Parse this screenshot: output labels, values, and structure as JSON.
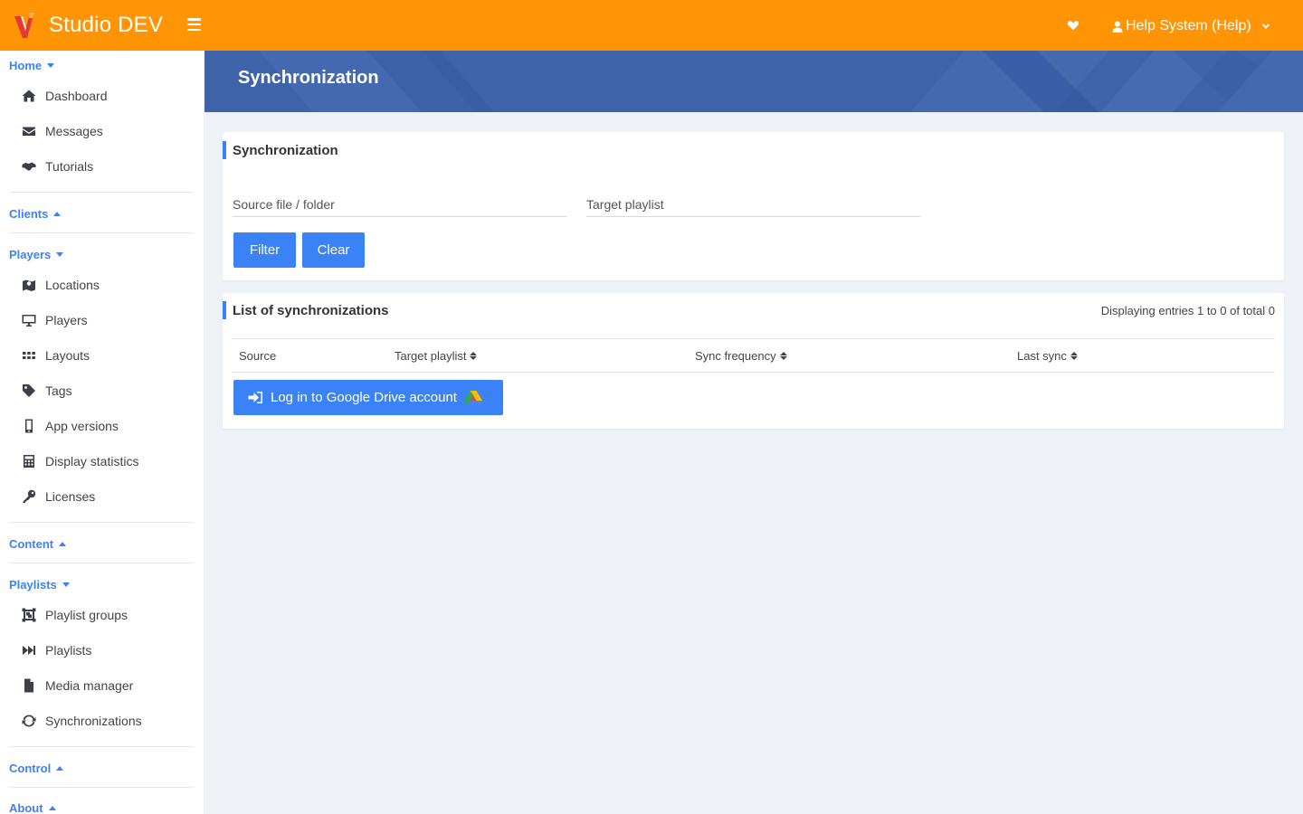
{
  "header": {
    "app_title": "Studio DEV",
    "user_label": "Help System (Help)",
    "brand_color": "#ff9505"
  },
  "sidebar": {
    "home": {
      "label": "Home",
      "items": [
        {
          "label": "Dashboard",
          "icon": "home-icon"
        },
        {
          "label": "Messages",
          "icon": "envelope-icon"
        },
        {
          "label": "Tutorials",
          "icon": "handshake-icon"
        }
      ]
    },
    "clients": {
      "label": "Clients"
    },
    "players": {
      "label": "Players",
      "items": [
        {
          "label": "Locations",
          "icon": "map-icon"
        },
        {
          "label": "Players",
          "icon": "monitor-icon"
        },
        {
          "label": "Layouts",
          "icon": "grid-icon"
        },
        {
          "label": "Tags",
          "icon": "tag-icon"
        },
        {
          "label": "App versions",
          "icon": "mobile-icon"
        },
        {
          "label": "Display statistics",
          "icon": "calculator-icon"
        },
        {
          "label": "Licenses",
          "icon": "key-icon"
        }
      ]
    },
    "content": {
      "label": "Content"
    },
    "playlists": {
      "label": "Playlists",
      "items": [
        {
          "label": "Playlist groups",
          "icon": "object-group-icon"
        },
        {
          "label": "Playlists",
          "icon": "fast-forward-icon"
        },
        {
          "label": "Media manager",
          "icon": "file-icon"
        },
        {
          "label": "Synchronizations",
          "icon": "sync-icon"
        }
      ]
    },
    "control": {
      "label": "Control"
    },
    "about": {
      "label": "About"
    }
  },
  "banner": {
    "title": "Synchronization"
  },
  "filter_card": {
    "title": "Synchronization",
    "source_placeholder": "Source file / folder",
    "target_placeholder": "Target playlist",
    "filter_label": "Filter",
    "clear_label": "Clear"
  },
  "list_card": {
    "title": "List of synchronizations",
    "entries_text": "Displaying entries 1 to 0 of total 0",
    "columns": [
      "Source",
      "Target playlist",
      "Sync frequency",
      "Last sync"
    ],
    "google_login_label": "Log in to Google Drive account"
  },
  "colors": {
    "accent": "#3b82f6",
    "banner": "#3e63a9"
  }
}
